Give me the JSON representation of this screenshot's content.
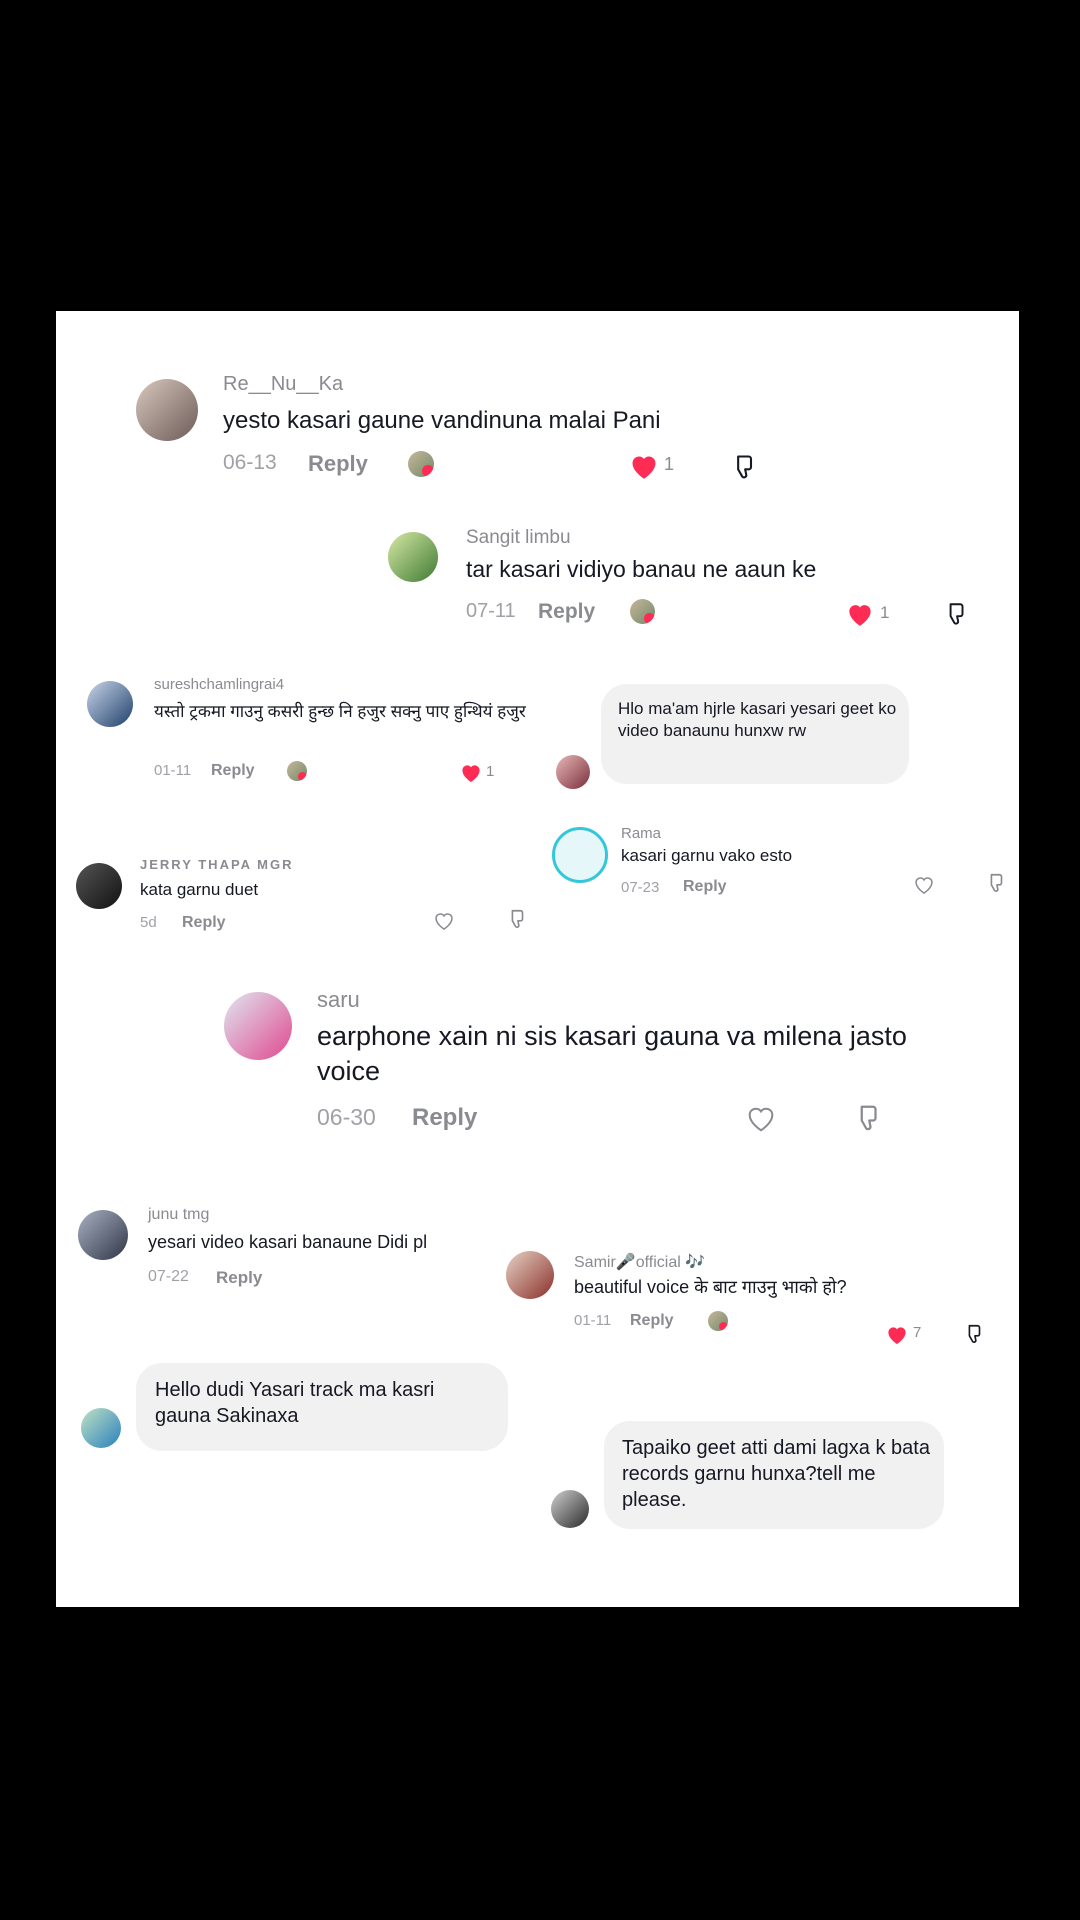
{
  "comments": [
    {
      "user": "Re__Nu__Ka",
      "text": "yesto kasari gaune vandinuna malai Pani",
      "date": "06-13",
      "reply": "Reply",
      "likes": "1"
    },
    {
      "user": "Sangit limbu",
      "text": "tar kasari vidiyo banau ne aaun ke",
      "date": "07-11",
      "reply": "Reply",
      "likes": "1"
    },
    {
      "user": "sureshchamlingrai4",
      "text": "यस्तो ट्रकमा गाउनु कसरी हुन्छ नि हजुर सक्नु पाए हुन्थियं हजुर",
      "date": "01-11",
      "reply": "Reply",
      "likes": "1"
    },
    {
      "text": "Hlo ma'am hjrle kasari yesari geet ko video banaunu hunxw rw"
    },
    {
      "user": "Rama",
      "text": "kasari garnu vako esto",
      "date": "07-23",
      "reply": "Reply"
    },
    {
      "user": "JERRY THAPA MGR",
      "text": "kata garnu duet",
      "date": "5d",
      "reply": "Reply"
    },
    {
      "user": "saru",
      "text": "earphone xain ni sis kasari gauna va milena jasto voice",
      "date": "06-30",
      "reply": "Reply"
    },
    {
      "user": "junu tmg",
      "text": "yesari video kasari banaune Didi pl",
      "date": "07-22",
      "reply": "Reply"
    },
    {
      "user": "Samir🎤official 🎶",
      "text": "beautiful voice के बाट गाउनु भाको हो?",
      "date": "01-11",
      "reply": "Reply",
      "likes": "7"
    },
    {
      "text": "Hello dudi Yasari track ma kasri gauna Sakinaxa"
    },
    {
      "text": "Tapaiko geet atti dami lagxa k bata  records garnu hunxa?tell me please."
    }
  ],
  "icons": {
    "like": "heart-icon",
    "dislike": "thumbs-down-icon",
    "avatar_badge": "creator-liked-badge"
  },
  "colors": {
    "background": "#000000",
    "panel": "#ffffff",
    "liked": "#fe2c55",
    "muted": "#8a8b91",
    "bubble": "#f1f1f2"
  }
}
